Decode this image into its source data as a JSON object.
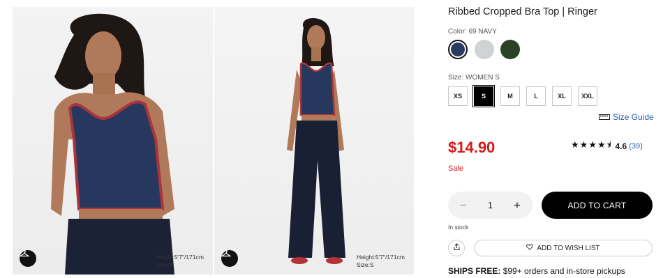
{
  "gallery": {
    "photos": [
      {
        "model_info_line1": "Height:5'7\"/171cm",
        "model_info_line2": "Size:S"
      },
      {
        "model_info_line1": "Height:5'7\"/171cm",
        "model_info_line2": "Size:S"
      }
    ],
    "hanger_icon": "hanger-icon"
  },
  "product": {
    "title": "Ribbed Cropped Bra Top | Ringer",
    "color_label": "Color: 69 NAVY",
    "colors": [
      {
        "hex": "#2b3a60",
        "selected": true
      },
      {
        "hex": "#d0d3d4",
        "selected": false
      },
      {
        "hex": "#2a4325",
        "selected": false
      }
    ],
    "size_label": "Size: WOMEN S",
    "sizes": [
      {
        "label": "XS",
        "selected": false
      },
      {
        "label": "S",
        "selected": true
      },
      {
        "label": "M",
        "selected": false
      },
      {
        "label": "L",
        "selected": false
      },
      {
        "label": "XL",
        "selected": false
      },
      {
        "label": "XXL",
        "selected": false
      }
    ],
    "size_guide": "Size Guide",
    "price": "$14.90",
    "sale_label": "Sale",
    "rating": {
      "stars": "★★★★⯨",
      "value": "4.6",
      "count": "(39)"
    },
    "quantity": "1",
    "add_to_cart": "ADD TO CART",
    "stock_status": "In stock",
    "wishlist": "ADD TO WISH LIST",
    "shipping_bold": "SHIPS FREE:",
    "shipping_rest": " $99+ orders and in-store pickups"
  },
  "colors": {
    "accent_red": "#d71a1a",
    "link_blue": "#2b5fa8",
    "button_black": "#000000"
  }
}
